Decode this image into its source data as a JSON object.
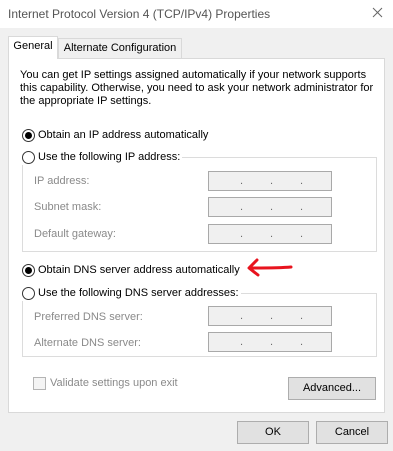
{
  "window": {
    "title": "Internet Protocol Version 4 (TCP/IPv4) Properties",
    "close_icon": "close-icon"
  },
  "tabs": [
    {
      "label": "General",
      "active": true
    },
    {
      "label": "Alternate Configuration",
      "active": false
    }
  ],
  "description": "You can get IP settings assigned automatically if your network supports this capability. Otherwise, you need to ask your network administrator for the appropriate IP settings.",
  "ip_section": {
    "auto_label": "Obtain an IP address automatically",
    "auto_selected": true,
    "manual_label": "Use the following IP address:",
    "manual_selected": false,
    "fields": [
      {
        "label": "IP address:",
        "value": ". . ."
      },
      {
        "label": "Subnet mask:",
        "value": ". . ."
      },
      {
        "label": "Default gateway:",
        "value": ". . ."
      }
    ]
  },
  "dns_section": {
    "auto_label": "Obtain DNS server address automatically",
    "auto_selected": true,
    "manual_label": "Use the following DNS server addresses:",
    "manual_selected": false,
    "fields": [
      {
        "label": "Preferred DNS server:",
        "value": ". . ."
      },
      {
        "label": "Alternate DNS server:",
        "value": ". . ."
      }
    ]
  },
  "annotation": {
    "icon": "red-arrow-icon",
    "color": "#e8141e"
  },
  "validate": {
    "label": "Validate settings upon exit",
    "checked": false,
    "enabled": false
  },
  "buttons": {
    "advanced": "Advanced...",
    "ok": "OK",
    "cancel": "Cancel"
  }
}
